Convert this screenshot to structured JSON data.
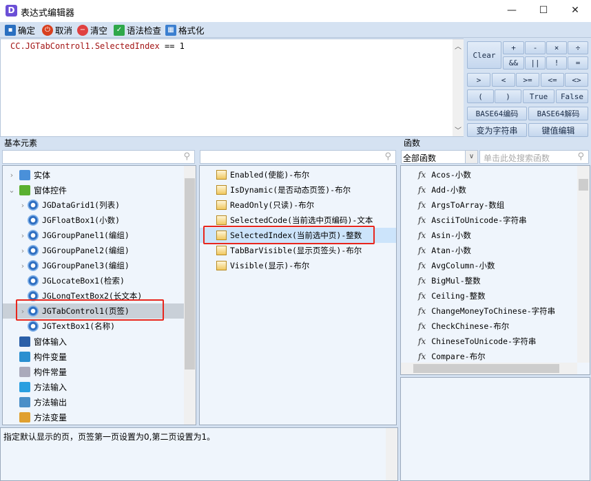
{
  "window": {
    "title": "表达式编辑器",
    "app_icon": "D",
    "minimize": "—",
    "maximize": "☐",
    "close": "✕"
  },
  "toolbar": {
    "ok": "确定",
    "cancel": "取消",
    "clear": "清空",
    "syntax_check": "语法检查",
    "format": "格式化"
  },
  "editor": {
    "expr_left": "CC.JGTabControl1.SelectedIndex",
    "expr_op": " == ",
    "expr_right": "1"
  },
  "keypad": {
    "clear": "Clear",
    "plus": "+",
    "minus": "-",
    "times": "×",
    "divide": "÷",
    "and": "&&",
    "or": "||",
    "not": "!",
    "eq": "=",
    "gt": ">",
    "lt": "<",
    "ge": ">=",
    "le": "<=",
    "ne": "<>",
    "lparen": "(",
    "rparen": ")",
    "true": "True",
    "false": "False",
    "b64enc": "BASE64编码",
    "b64dec": "BASE64解码",
    "to_string": "变为字符串",
    "kv_edit": "键值编辑"
  },
  "basic": {
    "label": "基本元素",
    "items": [
      {
        "label": "实体",
        "level": 0,
        "expand": ">"
      },
      {
        "label": "窗体控件",
        "level": 0,
        "expand": "v"
      },
      {
        "label": "JGDataGrid1(列表)",
        "level": 1,
        "expand": ">"
      },
      {
        "label": "JGFloatBox1(小数)",
        "level": 1,
        "expand": ""
      },
      {
        "label": "JGGroupPanel1(编组)",
        "level": 1,
        "expand": ">"
      },
      {
        "label": "JGGroupPanel2(编组)",
        "level": 1,
        "expand": ">"
      },
      {
        "label": "JGGroupPanel3(编组)",
        "level": 1,
        "expand": ">"
      },
      {
        "label": "JGLocateBox1(检索)",
        "level": 1,
        "expand": ""
      },
      {
        "label": "JGLongTextBox2(长文本)",
        "level": 1,
        "expand": ""
      },
      {
        "label": "JGTabControl1(页签)",
        "level": 1,
        "expand": ">",
        "selected": true
      },
      {
        "label": "JGTextBox1(名称)",
        "level": 1,
        "expand": ""
      },
      {
        "label": "窗体输入",
        "level": 0,
        "expand": "",
        "icon": "var-icon"
      },
      {
        "label": "构件变量",
        "level": 0,
        "expand": "",
        "icon": "variable-icon"
      },
      {
        "label": "构件常量",
        "level": 0,
        "expand": "",
        "icon": "constant-icon"
      },
      {
        "label": "方法输入",
        "level": 0,
        "expand": "",
        "icon": "method-input-icon"
      },
      {
        "label": "方法输出",
        "level": 0,
        "expand": "",
        "icon": "method-output-icon"
      },
      {
        "label": "方法变量",
        "level": 0,
        "expand": "",
        "icon": "method-variable-icon"
      }
    ]
  },
  "props": {
    "items": [
      "Enabled(使能)-布尔",
      "IsDynamic(是否动态页签)-布尔",
      "ReadOnly(只读)-布尔",
      "SelectedCode(当前选中页编码)-文本",
      "SelectedIndex(当前选中页)-整数",
      "TabBarVisible(显示页签头)-布尔",
      "Visible(显示)-布尔"
    ],
    "selected_index": 4
  },
  "functions": {
    "label": "函数",
    "category": "全部函数",
    "search_placeholder": "单击此处搜索函数",
    "items": [
      "Acos-小数",
      "Add-小数",
      "ArgsToArray-数组",
      "AsciiToUnicode-字符串",
      "Asin-小数",
      "Atan-小数",
      "AvgColumn-小数",
      "BigMul-整数",
      "Ceiling-整数",
      "ChangeMoneyToChinese-字符串",
      "CheckChinese-布尔",
      "ChineseToUnicode-字符串",
      "Compare-布尔"
    ]
  },
  "description": "指定默认显示的页，页签第一页设置为0,第二页设置为1。",
  "colors": {
    "accent": "#6b4fd6",
    "selection": "#cce4fb",
    "highlight_box": "#e8251c",
    "code": "#a31515"
  }
}
